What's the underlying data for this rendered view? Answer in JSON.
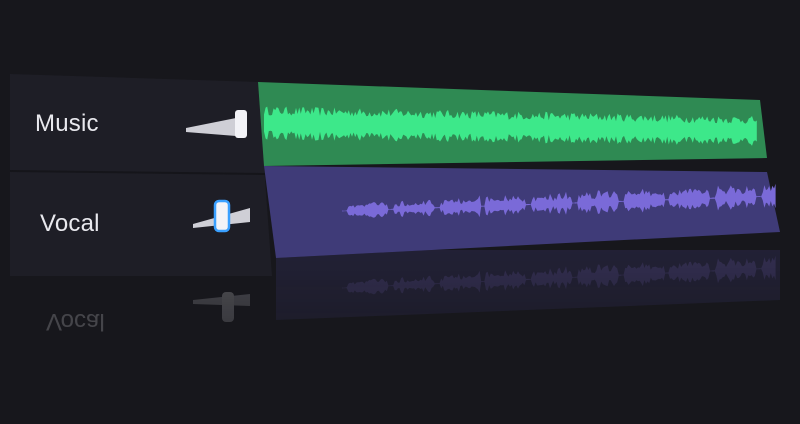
{
  "tracks": [
    {
      "id": "music",
      "label": "Music",
      "color": "#2f8a53",
      "wave_color": "#3de88a",
      "volume": 1.0,
      "selected": false
    },
    {
      "id": "vocal",
      "label": "Vocal",
      "color": "#3f3b78",
      "wave_color": "#7a6ad8",
      "volume": 0.45,
      "selected": true
    }
  ],
  "colors": {
    "background": "#17171c",
    "header_panel": "#1e1e26",
    "slider_track": "#cfcfd6",
    "thumb": "#f3f3f7",
    "thumb_selected_border": "#3aa0ff"
  }
}
